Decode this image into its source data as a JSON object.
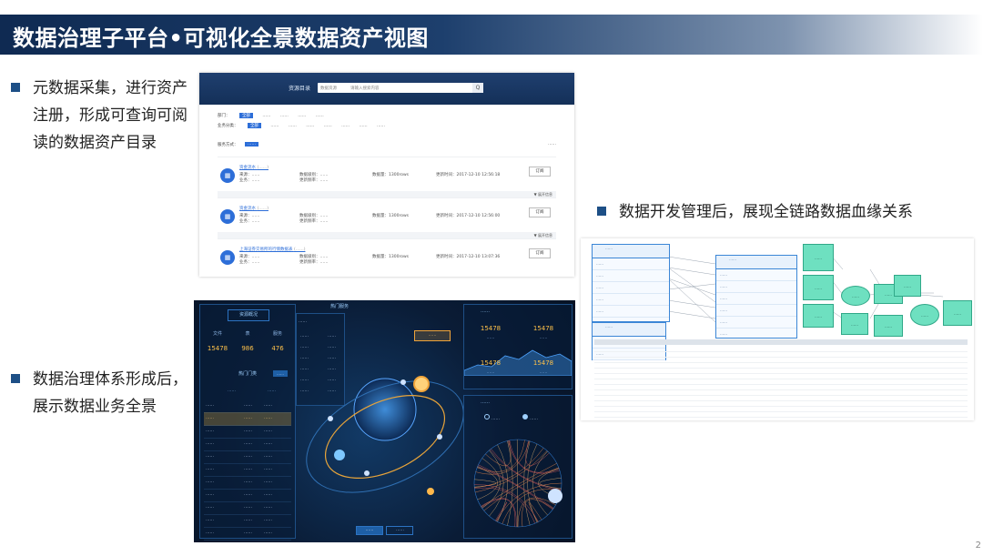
{
  "title": "数据治理子平台•可视化全景数据资产视图",
  "bullets": {
    "b1_lines": [
      "元数据采集，进行资产",
      "注册，形成可查询可阅",
      "读的数据资产目录"
    ],
    "b2_lines": [
      "数据治理体系形成后，",
      "展示数据业务全景"
    ],
    "b3": "数据开发管理后，展现全链路数据血缘关系"
  },
  "page_number": "2",
  "catalog": {
    "header_label": "资源目录",
    "search_select": "数据资源",
    "search_placeholder": "请输入搜索内容",
    "search_btn": "Q",
    "filters_row1": [
      "部门：",
      "全部",
      "……",
      "……",
      "……",
      "……"
    ],
    "filters_row2": [
      "业务分类：",
      "全部",
      "……",
      "……",
      "……",
      "……",
      "……",
      "……",
      "……"
    ],
    "sort_label": "服务方式：",
    "sort_btn": "……",
    "result_summary": "……",
    "subscribe_label": "订阅",
    "fold_label": "▼ 展开信息",
    "items": [
      {
        "name": "资金流水",
        "tag": "(……)",
        "meta1": "来源：……",
        "meta2": "业务：……",
        "c2a": "数据级别：……",
        "c2b": "更新频率：……",
        "c3": "数据量：1300rows",
        "c4": "更新时间：2017-12-10 12:56:18"
      },
      {
        "name": "资金流水",
        "tag": "(……)",
        "meta1": "来源：……",
        "meta2": "业务：……",
        "c2a": "数据级别：……",
        "c2b": "更新频率：……",
        "c3": "数据量：1300rows",
        "c4": "更新时间：2017-12-10 12:56:00"
      },
      {
        "name": "上海证券交易所的行情数据表",
        "tag": "(……)",
        "meta1": "来源：……",
        "meta2": "业务：……",
        "c2a": "数据级别：……",
        "c2b": "更新频率：……",
        "c3": "数据量：1300rows",
        "c4": "更新时间：2017-12-10 13:07:36"
      }
    ]
  },
  "dashboard": {
    "left_title": "资源概况",
    "stats": [
      {
        "label": "文件",
        "value": "15478"
      },
      {
        "label": "表",
        "value": "986"
      },
      {
        "label": "服务",
        "value": "476"
      }
    ],
    "hot_title": "热门门类",
    "hot_btn": "……",
    "table_head": [
      "……",
      "……"
    ],
    "rows": [
      {
        "name": "……",
        "num": "……",
        "tag": "……"
      },
      {
        "name": "……",
        "num": "……",
        "tag": "……"
      },
      {
        "name": "……",
        "num": "……",
        "tag": "……"
      },
      {
        "name": "……",
        "num": "……",
        "tag": "……"
      },
      {
        "name": "……",
        "num": "……",
        "tag": "……"
      },
      {
        "name": "……",
        "num": "……",
        "tag": "……"
      },
      {
        "name": "……",
        "num": "……",
        "tag": "……"
      },
      {
        "name": "……",
        "num": "……",
        "tag": "……"
      },
      {
        "name": "……",
        "num": "……",
        "tag": "……"
      },
      {
        "name": "……",
        "num": "……",
        "tag": "……"
      },
      {
        "name": "……",
        "num": "……",
        "tag": "……"
      }
    ],
    "mid_title": "热门服务",
    "mid_head": "……",
    "mid_rows": [
      {
        "name": "……",
        "num": "……"
      },
      {
        "name": "……",
        "num": "……"
      },
      {
        "name": "……",
        "num": "……"
      },
      {
        "name": "……",
        "num": "……"
      },
      {
        "name": "……",
        "num": "……"
      },
      {
        "name": "……",
        "num": "……"
      }
    ],
    "callout": "……",
    "right_title": "……",
    "right_numbers": [
      {
        "value": "15478",
        "label": "……"
      },
      {
        "value": "15478",
        "label": "……"
      },
      {
        "value": "15478",
        "label": "……"
      },
      {
        "value": "15478",
        "label": "……"
      }
    ],
    "right2_title": "……",
    "legend": [
      "……",
      "……"
    ],
    "bottom_tabs": [
      "……",
      "……"
    ]
  },
  "lineage": {
    "tables": [
      {
        "head": "……",
        "rows": [
          "……",
          "……",
          "……",
          "……",
          "……",
          "……"
        ]
      },
      {
        "head": "……",
        "rows": [
          "……",
          "……",
          "……",
          "……",
          "……",
          "……",
          "……"
        ]
      },
      {
        "head": "……",
        "rows": [
          "……",
          "……",
          "……"
        ]
      }
    ],
    "green_nodes": [
      "……",
      "……",
      "……",
      "……",
      "……",
      "……",
      "……",
      "……",
      "……",
      "……"
    ],
    "grid_rows": 14
  }
}
